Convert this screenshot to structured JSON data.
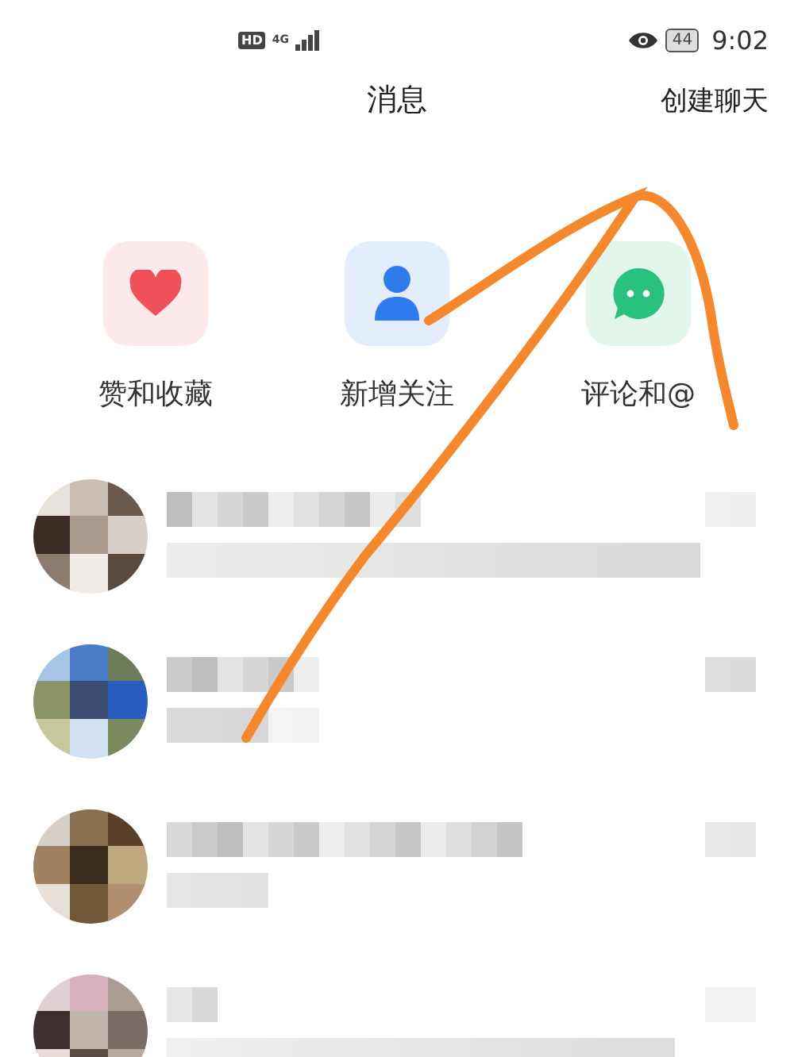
{
  "status_bar": {
    "hd": "HD",
    "network": "4G",
    "battery": "44",
    "time": "9:02"
  },
  "header": {
    "title": "消息",
    "action": "创建聊天"
  },
  "shortcuts": [
    {
      "kind": "heart",
      "label": "赞和收藏"
    },
    {
      "kind": "person",
      "label": "新增关注"
    },
    {
      "kind": "chat",
      "label": "评论和@"
    }
  ],
  "conversations": [
    {
      "kind": "pixelated"
    },
    {
      "kind": "pixelated"
    },
    {
      "kind": "pixelated"
    },
    {
      "kind": "pixelated"
    }
  ]
}
